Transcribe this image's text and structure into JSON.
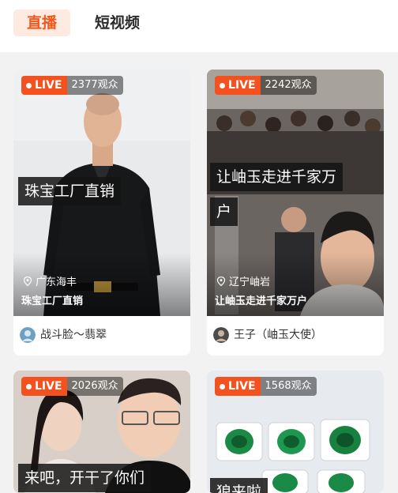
{
  "tabs": [
    {
      "label": "直播"
    },
    {
      "label": "短视频"
    }
  ],
  "cards": [
    {
      "live_label": "LIVE",
      "viewers": "2377观众",
      "caption": "珠宝工厂直销",
      "location": "广东海丰",
      "title": "珠宝工厂直销",
      "author": "战斗脸～翡翠"
    },
    {
      "live_label": "LIVE",
      "viewers": "2242观众",
      "caption_line1": "让岫玉走进千家万",
      "caption_line2": "户",
      "location": "辽宁岫岩",
      "title": "让岫玉走进千家万户",
      "author": "王子（岫玉大使）"
    },
    {
      "live_label": "LIVE",
      "viewers": "2026观众",
      "caption": "来吧，开干了你们"
    },
    {
      "live_label": "LIVE",
      "viewers": "1568观众",
      "caption": "狼来啦"
    }
  ],
  "colors": {
    "accent": "#f0581e",
    "live_red": "#f4511e",
    "tab_active_bg": "#fdeae1",
    "page_bg": "#f2f2f2"
  },
  "icons": [
    "location-pin-icon",
    "live-dot-icon"
  ]
}
